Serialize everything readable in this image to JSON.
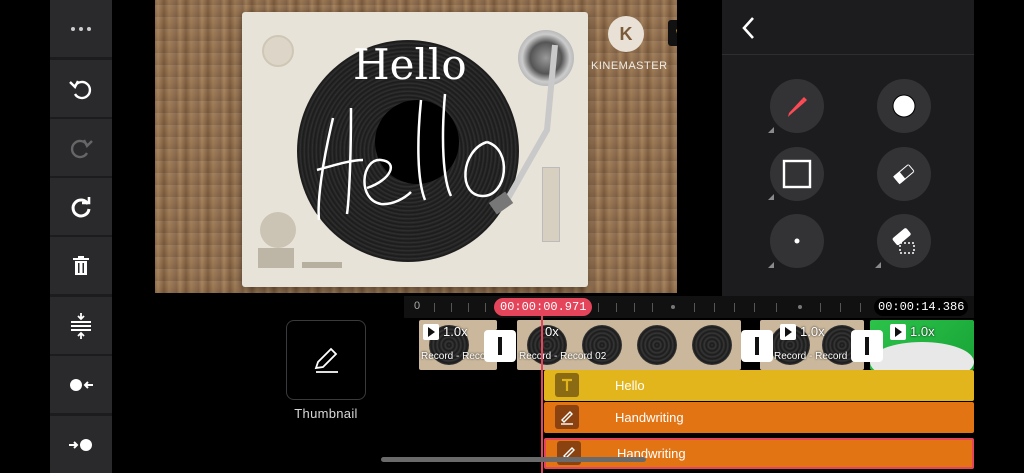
{
  "toolbar": {
    "items": [
      {
        "icon": "more-icon"
      },
      {
        "icon": "undo-icon"
      },
      {
        "icon": "redo-icon"
      },
      {
        "icon": "restore-icon"
      },
      {
        "icon": "trash-icon"
      },
      {
        "icon": "split-layer-icon"
      },
      {
        "icon": "record-in-icon"
      },
      {
        "icon": "record-out-icon"
      }
    ]
  },
  "preview": {
    "overlay_text": "Hello",
    "handwriting_text": "Hello",
    "watermark_letter": "K",
    "watermark_text": "KINEMASTER",
    "premium_icon": "crown-icon"
  },
  "right_panel": {
    "back_icon": "chevron-left-icon",
    "tools": [
      {
        "name": "pen",
        "icon": "pen-icon"
      },
      {
        "name": "color",
        "icon": "color-circle-icon",
        "color": "#ffffff"
      },
      {
        "name": "shape",
        "icon": "square-icon"
      },
      {
        "name": "eraser",
        "icon": "eraser-icon"
      },
      {
        "name": "brush-size",
        "icon": "dot-icon"
      },
      {
        "name": "clear",
        "icon": "eraser-clear-icon"
      }
    ]
  },
  "timeline": {
    "thumbnail_label": "Thumbnail",
    "ruler_start": "0",
    "current_time": "00:00:00.971",
    "total_time": "00:00:14.386",
    "clips": [
      {
        "speed": "1.0x",
        "name": "Record - Reco"
      },
      {
        "speed": "0x",
        "name": "Record - Record 02"
      },
      {
        "speed": "1.0x",
        "name": "Record - Record"
      },
      {
        "speed": "1.0x",
        "name": ""
      }
    ],
    "tracks": [
      {
        "label": "Hello",
        "color": "#e3b51c",
        "icon": "text-icon"
      },
      {
        "label": "Handwriting",
        "color": "#e37414",
        "icon": "handwriting-icon"
      },
      {
        "label": "Handwriting",
        "color": "#e37414",
        "icon": "handwriting-icon"
      }
    ]
  },
  "colors": {
    "accent": "#e5455a",
    "panel": "#1c1c1e",
    "text_track": "#e3b51c",
    "handwriting_track": "#e37414"
  }
}
